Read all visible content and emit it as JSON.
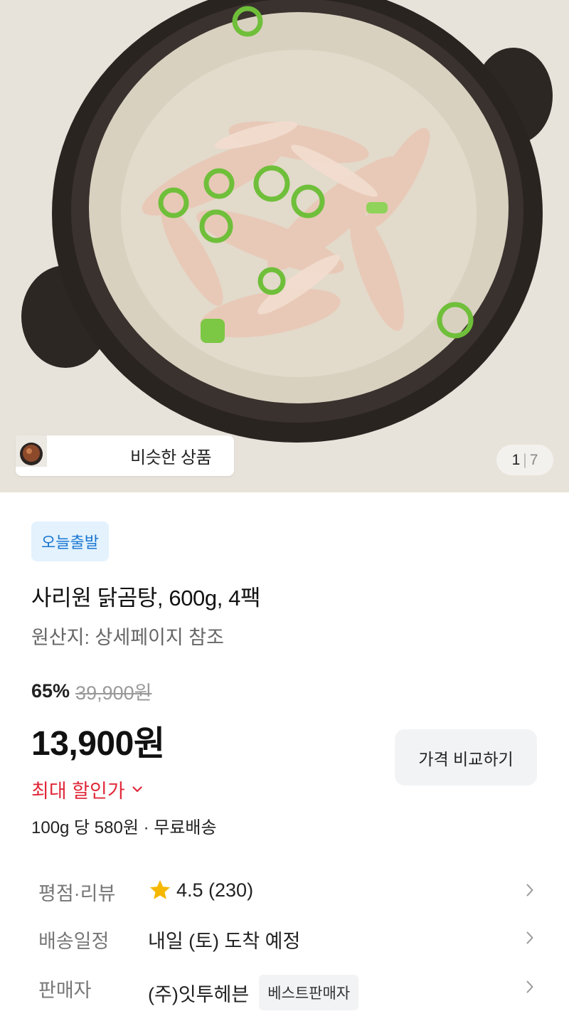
{
  "gallery": {
    "similar_label": "비슷한 상품",
    "current_page": "1",
    "separator": "|",
    "total_pages": "7"
  },
  "product": {
    "badge": "오늘출발",
    "title": "사리원 닭곰탕, 600g, 4팩",
    "origin": "원산지: 상세페이지 참조"
  },
  "price": {
    "discount_rate": "65%",
    "original_price": "39,900원",
    "sale_price": "13,900원",
    "max_discount_label": "최대 할인가",
    "unit_price": "100g 당 580원 · 무료배송",
    "compare_button": "가격 비교하기"
  },
  "info": {
    "rating": {
      "label": "평점·리뷰",
      "value": "4.5 (230)"
    },
    "shipping": {
      "label": "배송일정",
      "value": "내일 (토) 도착 예정"
    },
    "seller": {
      "label": "판매자",
      "value": "(주)잇투헤븐",
      "badge": "베스트판매자"
    }
  },
  "colors": {
    "accent_red": "#e0293a",
    "badge_blue": "#1976d2",
    "badge_blue_bg": "#e3f2fd",
    "star": "#f5b700"
  },
  "icons": [
    "star-icon",
    "chevron-down-icon",
    "chevron-right-icon"
  ]
}
